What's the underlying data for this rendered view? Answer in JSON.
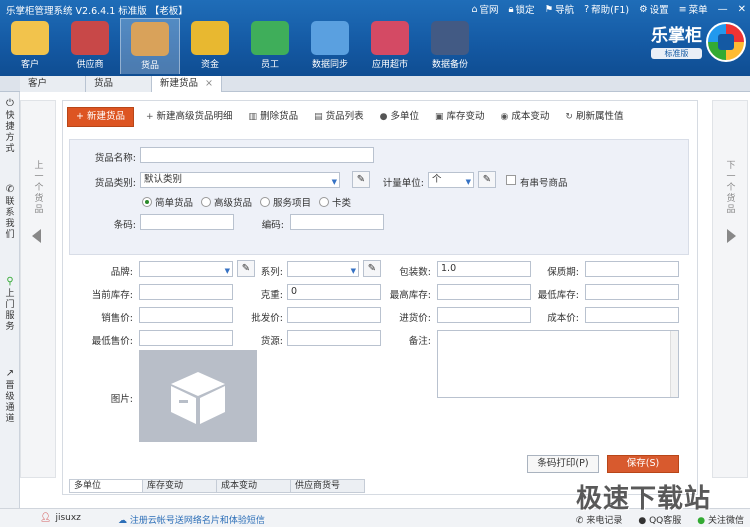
{
  "window": {
    "title": "乐掌柜管理系统 V2.6.4.1 标准版 【老板】",
    "links": [
      "官网",
      "锁定",
      "导航",
      "帮助(F1)",
      "设置",
      "菜单"
    ]
  },
  "nav": [
    {
      "label": "客户",
      "color": "#f2c34c"
    },
    {
      "label": "供应商",
      "color": "#c84848"
    },
    {
      "label": "货品",
      "color": "#d9a25a"
    },
    {
      "label": "资金",
      "color": "#e8b830"
    },
    {
      "label": "员工",
      "color": "#3fae5a"
    },
    {
      "label": "数据同步",
      "color": "#5aa0e0"
    },
    {
      "label": "应用超市",
      "color": "#d44a64"
    },
    {
      "label": "数据备份",
      "color": "#425a84"
    }
  ],
  "brand": {
    "name": "乐掌柜",
    "edition": "标准版"
  },
  "tabs": [
    "客户",
    "货品",
    "新建货品"
  ],
  "leftbar": [
    "快捷方式",
    "联系我们",
    "上门服务",
    "晋级通道"
  ],
  "prev_label": "上一个货品",
  "next_label": "下一个货品",
  "toolbar": {
    "new": "新建货品",
    "new_adv": "新建高级货品明细",
    "delete": "删除货品",
    "list": "货品列表",
    "multi_unit": "多单位",
    "stock": "库存变动",
    "cost": "成本变动",
    "refresh": "刷新属性值"
  },
  "form": {
    "name_label": "货品名称:",
    "category_label": "货品类别:",
    "category_value": "默认类别",
    "unit_label": "计量单位:",
    "unit_value": "个",
    "serial_label": "有串号商品",
    "radios": [
      "简单货品",
      "高级货品",
      "服务项目",
      "卡类"
    ],
    "barcode_label": "条码:",
    "code_label": "编码:",
    "brand_label": "品牌:",
    "series_label": "系列:",
    "pack_label": "包装数:",
    "pack_value": "1.0",
    "shelf_label": "保质期:",
    "cur_stock_label": "当前库存:",
    "weight_label": "克重:",
    "weight_value": "0",
    "max_stock_label": "最高库存:",
    "min_stock_label": "最低库存:",
    "sale_label": "销售价:",
    "wholesale_label": "批发价:",
    "purchase_label": "进货价:",
    "cost_label": "成本价:",
    "min_sale_label": "最低售价:",
    "source_label": "货源:",
    "remark_label": "备注:",
    "image_label": "图片:"
  },
  "buttons": {
    "barcode": "条码打印(P)",
    "save": "保存(S)"
  },
  "bottom_tabs": [
    "多单位",
    "库存变动",
    "成本变动",
    "供应商货号"
  ],
  "status": {
    "user": "jisuxz",
    "register": "注册云帐号送网络名片和体验短信",
    "items": [
      "来电记录",
      "QQ客服",
      "关注微信"
    ]
  },
  "watermark": "极速下载站"
}
